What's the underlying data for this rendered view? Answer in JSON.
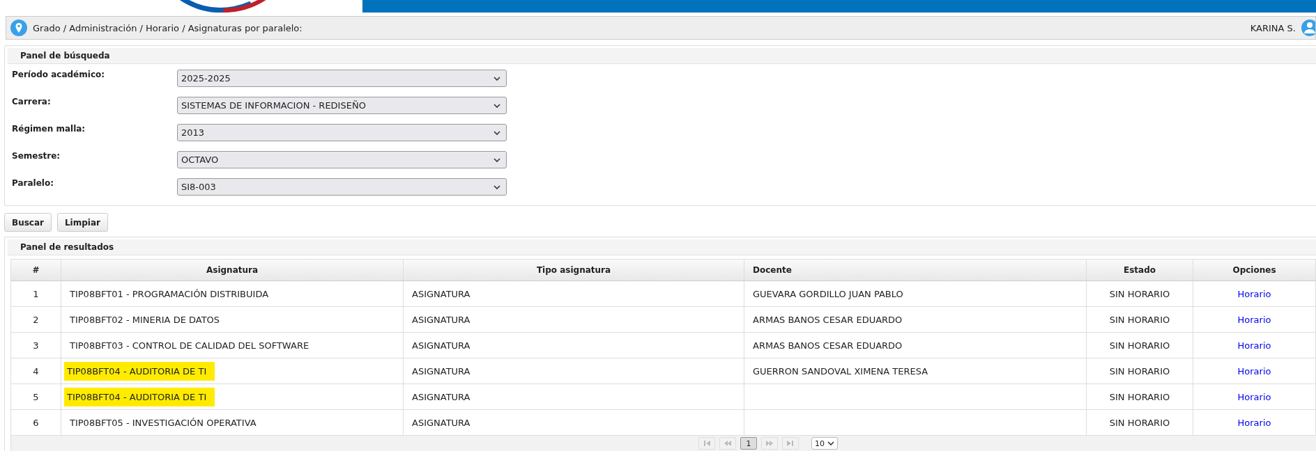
{
  "breadcrumb": "Grado / Administración / Horario / Asignaturas por paralelo:",
  "user": "KARINA S.",
  "search_panel": {
    "title": "Panel de búsqueda",
    "fields": [
      {
        "label": "Período académico:",
        "value": "2025-2025"
      },
      {
        "label": "Carrera:",
        "value": "SISTEMAS DE INFORMACION - REDISEÑO"
      },
      {
        "label": "Régimen malla:",
        "value": "2013"
      },
      {
        "label": "Semestre:",
        "value": "OCTAVO"
      },
      {
        "label": "Paralelo:",
        "value": "SI8-003"
      }
    ]
  },
  "buttons": [
    "Buscar",
    "Limpiar"
  ],
  "results_panel": {
    "title": "Panel de resultados",
    "table": {
      "columns": [
        "#",
        "Asignatura",
        "Tipo asignatura",
        "Docente",
        "Estado",
        "Opciones"
      ],
      "rows": [
        {
          "n": "1",
          "asignatura": "TIP08BFT01 - PROGRAMACIÓN DISTRIBUIDA",
          "tipo": "ASIGNATURA",
          "docente": "GUEVARA GORDILLO JUAN PABLO",
          "estado": "SIN HORARIO",
          "opcion": "Horario",
          "highlighted": false
        },
        {
          "n": "2",
          "asignatura": "TIP08BFT02 - MINERIA DE DATOS",
          "tipo": "ASIGNATURA",
          "docente": "ARMAS BANOS CESAR EDUARDO",
          "estado": "SIN HORARIO",
          "opcion": "Horario",
          "highlighted": false
        },
        {
          "n": "3",
          "asignatura": "TIP08BFT03 - CONTROL DE CALIDAD DEL SOFTWARE",
          "tipo": "ASIGNATURA",
          "docente": "ARMAS BANOS CESAR EDUARDO",
          "estado": "SIN HORARIO",
          "opcion": "Horario",
          "highlighted": false
        },
        {
          "n": "4",
          "asignatura": "TIP08BFT04 - AUDITORIA DE TI",
          "tipo": "ASIGNATURA",
          "docente": "GUERRON SANDOVAL XIMENA TERESA",
          "estado": "SIN HORARIO",
          "opcion": "Horario",
          "highlighted": true
        },
        {
          "n": "5",
          "asignatura": "TIP08BFT04 - AUDITORIA DE TI",
          "tipo": "ASIGNATURA",
          "docente": "",
          "estado": "SIN HORARIO",
          "opcion": "Horario",
          "highlighted": true
        },
        {
          "n": "6",
          "asignatura": "TIP08BFT05 - INVESTIGACIÓN OPERATIVA",
          "tipo": "ASIGNATURA",
          "docente": "",
          "estado": "SIN HORARIO",
          "opcion": "Horario",
          "highlighted": false
        }
      ]
    },
    "pagination": {
      "pages": [
        {
          "label": "1",
          "selected": true
        }
      ],
      "page_size": "10"
    }
  }
}
